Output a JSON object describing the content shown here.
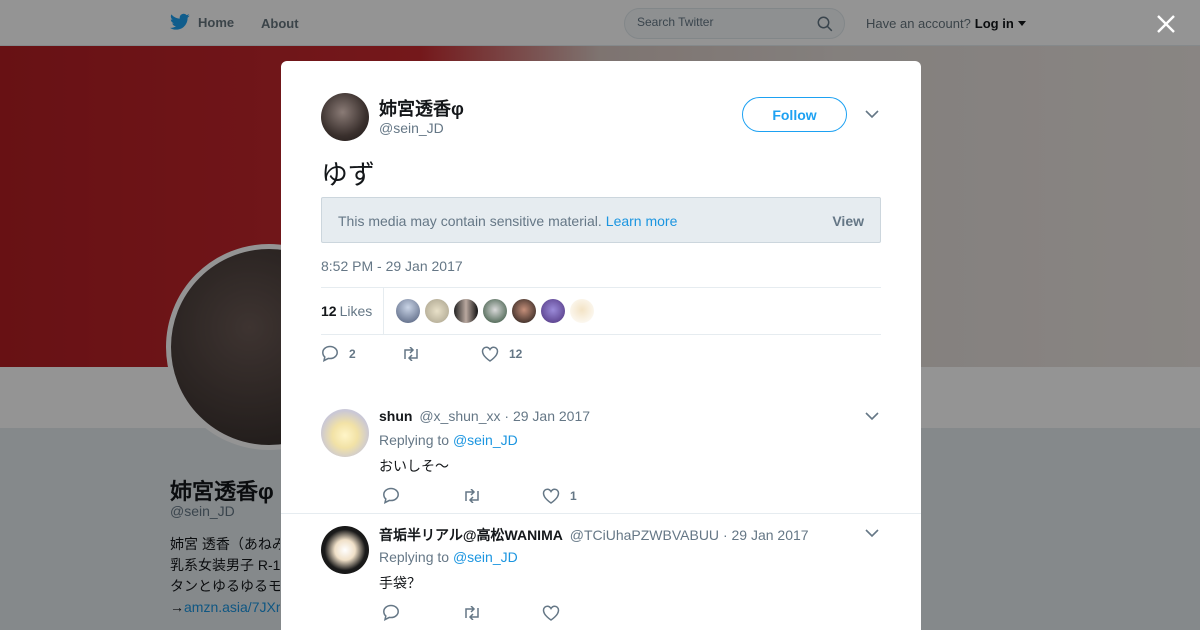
{
  "nav": {
    "home_label": "Home",
    "about_label": "About",
    "search_placeholder": "Search Twitter",
    "account_text": "Have an account?",
    "login_label": "Log in"
  },
  "background_profile": {
    "name": "姉宮透香φ",
    "handle": "@sein_JD",
    "bio_lines": [
      "姉宮 透香（あねみ",
      "乳系女装男子 R-1",
      "タンとゆるゆるモ"
    ],
    "bio_link_prefix": "→",
    "bio_link": "amzn.asia/7JXr"
  },
  "tweet": {
    "author_name": "姉宮透香φ",
    "author_handle": "@sein_JD",
    "follow_label": "Follow",
    "text": "ゆず",
    "sensitive_message": "This media may contain sensitive material.",
    "learn_more_label": "Learn more",
    "view_label": "View",
    "timestamp": "8:52 PM - 29 Jan 2017",
    "likes_count": "12",
    "likes_label": "Likes",
    "reply_count": "2",
    "retweet_count": "",
    "like_count": "12"
  },
  "replies": [
    {
      "name": "shun",
      "handle": "@x_shun_xx",
      "date": "· 29 Jan 2017",
      "replying_prefix": "Replying to",
      "replying_to": "@sein_JD",
      "text": "おいしそ〜",
      "reply_count": "",
      "retweet_count": "",
      "like_count": "1"
    },
    {
      "name": "音垢半リアル@高松WANIMA",
      "handle": "@TCiUhaPZWBVABUU",
      "date": "· 29 Jan 2017",
      "replying_prefix": "Replying to",
      "replying_to": "@sein_JD",
      "text": "手袋？",
      "reply_count": "",
      "retweet_count": "",
      "like_count": ""
    }
  ],
  "colors": {
    "brand": "#1da1f2",
    "link": "#1b95e0",
    "secondary_text": "#657786"
  }
}
